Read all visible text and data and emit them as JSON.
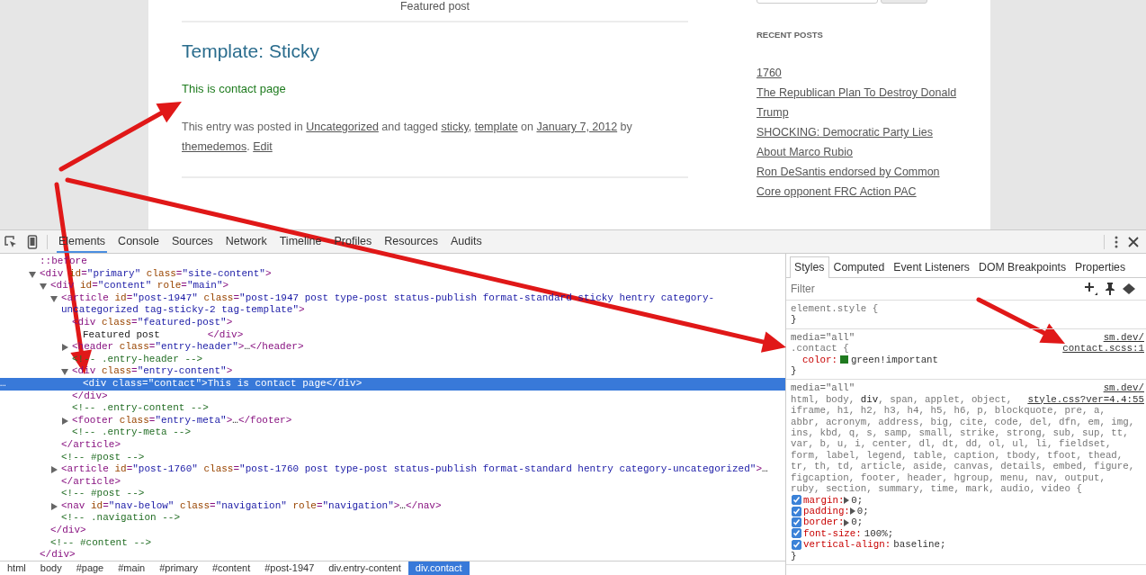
{
  "page": {
    "featured_label": "Featured post",
    "post_title": "Template: Sticky",
    "post_body": "This is contact page",
    "post_meta": [
      {
        "text": "This entry was posted in ",
        "link": "Uncategorized"
      },
      {
        "text": " and tagged ",
        "link": "sticky"
      },
      {
        "text": ", ",
        "link": "template"
      },
      {
        "text": " on ",
        "link": "January 7, 2012"
      },
      {
        "text": " by ",
        "link": "themedemos"
      },
      {
        "text": ". ",
        "link": "Edit"
      }
    ],
    "sidebar": {
      "heading": "RECENT POSTS",
      "posts": [
        "1760",
        "The Republican Plan To Destroy Donald Trump",
        "SHOCKING: Democratic Party Lies About Marco Rubio",
        "Ron DeSantis endorsed by Common Core opponent FRC Action PAC"
      ]
    }
  },
  "devtools": {
    "tabs": [
      {
        "label": "Elements",
        "selected": true
      },
      {
        "label": "Console",
        "selected": false
      },
      {
        "label": "Sources",
        "selected": false
      },
      {
        "label": "Network",
        "selected": false
      },
      {
        "label": "Timeline",
        "selected": false
      },
      {
        "label": "Profiles",
        "selected": false
      },
      {
        "label": "Resources",
        "selected": false
      },
      {
        "label": "Audits",
        "selected": false
      }
    ],
    "dom_tree": [
      {
        "text": "::before",
        "selected": false
      },
      {
        "text": "<div id=\"primary\" class=\"site-content\">",
        "expanded": true,
        "selected": false,
        "closing": "</div>",
        "children": [
          {
            "text": "<div id=\"content\" role=\"main\">",
            "expanded": true,
            "selected": false,
            "closing": "</div>",
            "children": [
              {
                "text": "<article id=\"post-1947\" class=\"post-1947 post type-post status-publish format-standard sticky hentry category-uncategorized tag-sticky-2 tag-template\">",
                "expanded": true,
                "selected": false,
                "closing": "</article>",
                "children": [
                  {
                    "text": "<div class=\"featured-post\">",
                    "selected": false,
                    "children": [
                      {
                        "text": "Featured post        </div>",
                        "selected": false
                      }
                    ]
                  },
                  {
                    "text": "<header class=\"entry-header\">…</header>",
                    "expanded": false,
                    "selected": false
                  },
                  {
                    "text": "<!-- .entry-header -->",
                    "selected": false
                  },
                  {
                    "text": "<div class=\"entry-content\">",
                    "expanded": true,
                    "selected": false,
                    "closing": "</div>",
                    "children": [
                      {
                        "text": "<div class=\"contact\">This is contact page</div>",
                        "selected": true,
                        "gutter": "…"
                      }
                    ]
                  },
                  {
                    "text": "<!-- .entry-content -->",
                    "selected": false
                  },
                  {
                    "text": "<footer class=\"entry-meta\">…</footer>",
                    "expanded": false,
                    "selected": false
                  },
                  {
                    "text": "<!-- .entry-meta -->",
                    "selected": false
                  }
                ]
              },
              {
                "text": "<!-- #post -->",
                "selected": false
              },
              {
                "text": "<article id=\"post-1760\" class=\"post-1760 post type-post status-publish format-standard hentry category-uncategorized\">…</article>",
                "expanded": false,
                "selected": false
              },
              {
                "text": "<!-- #post -->",
                "selected": false
              },
              {
                "text": "<nav id=\"nav-below\" class=\"navigation\" role=\"navigation\">…</nav>",
                "expanded": false,
                "selected": false
              },
              {
                "text": "<!-- .navigation -->",
                "selected": false
              }
            ]
          },
          {
            "text": "<!-- #content -->",
            "selected": false
          }
        ]
      }
    ],
    "breadcrumbs": [
      {
        "label": "html",
        "selected": false
      },
      {
        "label": "body",
        "selected": false
      },
      {
        "label": "#page",
        "selected": false
      },
      {
        "label": "#main",
        "selected": false
      },
      {
        "label": "#primary",
        "selected": false
      },
      {
        "label": "#content",
        "selected": false
      },
      {
        "label": "#post-1947",
        "selected": false
      },
      {
        "label": "div.entry-content",
        "selected": false
      },
      {
        "label": "div.contact",
        "selected": true
      }
    ],
    "sidebar_tabs": [
      {
        "label": "Styles",
        "selected": true
      },
      {
        "label": "Computed",
        "selected": false
      },
      {
        "label": "Event Listeners",
        "selected": false
      },
      {
        "label": "DOM Breakpoints",
        "selected": false
      },
      {
        "label": "Properties",
        "selected": false
      }
    ],
    "filter": {
      "placeholder": "Filter"
    },
    "rules": [
      {
        "selector_lines": [
          "element.style {"
        ],
        "close": "}"
      },
      {
        "media": "media=\"all\"",
        "source": [
          "sm.dev/",
          "contact.scss:1"
        ],
        "selector_lines": [
          ".contact {"
        ],
        "properties": [
          {
            "name": "color:",
            "value": "green!important",
            "color": "#1f7a1f"
          }
        ],
        "close": "}"
      },
      {
        "media": "media=\"all\"",
        "source": [
          "sm.dev/",
          "style.css?ver=4.4:55"
        ],
        "selector_lines": [
          "html, body, **div**, span, applet, object,",
          "iframe, h1, h2, h3, h4, h5, h6, p, blockquote, pre, a,",
          "abbr, acronym, address, big, cite, code, del, dfn, em, img,",
          "ins, kbd, q, s, samp, small, strike, strong, sub, sup, tt,",
          "var, b, u, i, center, dl, dt, dd, ol, ul, li, fieldset,",
          "form, label, legend, table, caption, tbody, tfoot, thead,",
          "tr, th, td, article, aside, canvas, details, embed, figure,",
          "figcaption, footer, header, hgroup, menu, nav, output,",
          "ruby, section, summary, time, mark, audio, video {"
        ],
        "properties": [
          {
            "name": "margin:",
            "value": "0;",
            "checked": true,
            "expandable": true
          },
          {
            "name": "padding:",
            "value": "0;",
            "checked": true,
            "expandable": true
          },
          {
            "name": "border:",
            "value": "0;",
            "checked": true,
            "expandable": true
          },
          {
            "name": "font-size:",
            "value": "100%;",
            "checked": true,
            "expandable": false
          },
          {
            "name": "vertical-align:",
            "value": "baseline;",
            "checked": true,
            "expandable": false
          }
        ],
        "close": "}"
      }
    ]
  }
}
